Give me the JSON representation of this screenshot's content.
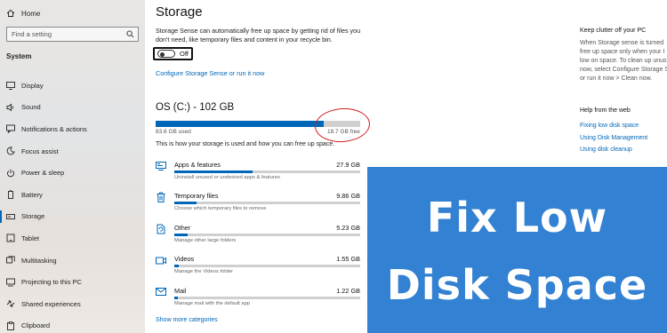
{
  "sidebar": {
    "home_label": "Home",
    "search_placeholder": "Find a setting",
    "section_label": "System",
    "items": [
      {
        "label": "Display",
        "icon": "display-icon"
      },
      {
        "label": "Sound",
        "icon": "sound-icon"
      },
      {
        "label": "Notifications & actions",
        "icon": "notifications-icon"
      },
      {
        "label": "Focus assist",
        "icon": "focus-assist-icon"
      },
      {
        "label": "Power & sleep",
        "icon": "power-icon"
      },
      {
        "label": "Battery",
        "icon": "battery-icon"
      },
      {
        "label": "Storage",
        "icon": "storage-icon",
        "active": true
      },
      {
        "label": "Tablet",
        "icon": "tablet-icon"
      },
      {
        "label": "Multitasking",
        "icon": "multitasking-icon"
      },
      {
        "label": "Projecting to this PC",
        "icon": "projecting-icon"
      },
      {
        "label": "Shared experiences",
        "icon": "shared-experiences-icon"
      },
      {
        "label": "Clipboard",
        "icon": "clipboard-icon"
      }
    ]
  },
  "main": {
    "title": "Storage",
    "sense_description": "Storage Sense can automatically free up space by getting rid of files you don't need, like temporary files and content in your recycle bin.",
    "toggle_label": "Off",
    "toggle_on": false,
    "configure_link": "Configure Storage Sense or run it now",
    "drive": {
      "title": "OS (C:) - 102 GB",
      "used_label": "83.6 GB used",
      "free_label": "18.7 GB free",
      "used_fraction": 0.82
    },
    "how_text": "This is how your storage is used and how you can free up space.",
    "categories": [
      {
        "name": "Apps & features",
        "size": "27.9 GB",
        "desc": "Uninstall unused or undesired apps & features",
        "fraction": 0.42,
        "icon": "apps-icon"
      },
      {
        "name": "Temporary files",
        "size": "9.86 GB",
        "desc": "Choose which temporary files to remove",
        "fraction": 0.12,
        "icon": "trash-icon"
      },
      {
        "name": "Other",
        "size": "5.23 GB",
        "desc": "Manage other large folders",
        "fraction": 0.07,
        "icon": "other-icon"
      },
      {
        "name": "Videos",
        "size": "1.55 GB",
        "desc": "Manage the Videos folder",
        "fraction": 0.025,
        "icon": "video-icon"
      },
      {
        "name": "Mail",
        "size": "1.22 GB",
        "desc": "Manage mail with the default app",
        "fraction": 0.02,
        "icon": "mail-icon"
      }
    ],
    "more_link": "Show more categories"
  },
  "right": {
    "title": "Keep clutter off your PC",
    "description": "When Storage sense is turned\nfree up space only when your I\nlow on space. To clean up unus\nnow, select Configure Storage S\nor run it now > Clean now.",
    "help_title": "Help from the web",
    "links": [
      "Fixing low disk space",
      "Using Disk Management",
      "Using disk cleanup"
    ]
  },
  "banner": {
    "line1": "Fix Low",
    "line2": "Disk Space"
  },
  "colors": {
    "accent": "#0067b8",
    "banner_bg": "#3381d2",
    "highlight_ring": "#d51f1f"
  }
}
